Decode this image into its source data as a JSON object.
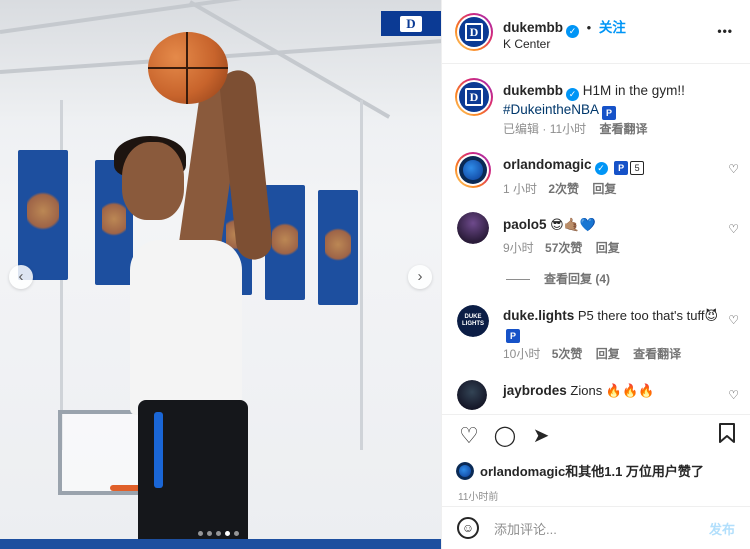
{
  "header": {
    "username": "dukembb",
    "follow_label": "关注",
    "location": "K Center",
    "more_label": "•••"
  },
  "caption": {
    "username": "dukembb",
    "text": "H1M in the gym!!",
    "hashtag": "#DukeintheNBA",
    "badge": "P",
    "edited": "已编辑",
    "time": "11小时",
    "translate": "查看翻译"
  },
  "comments": [
    {
      "username": "orlandomagic",
      "text": "",
      "badges": [
        "P",
        "5"
      ],
      "time": "1 小时",
      "likes": "2次赞",
      "reply": "回复"
    },
    {
      "username": "paolo5",
      "text": "😎🤙🏽💙",
      "time": "9小时",
      "likes": "57次赞",
      "reply": "回复",
      "view_replies": "查看回复 (4)"
    },
    {
      "username": "duke.lights",
      "text": "P5 there too that's tuff😈",
      "badge": "P",
      "time": "10小时",
      "likes": "5次赞",
      "reply": "回复",
      "translate": "查看翻译"
    },
    {
      "username": "jaybrodes",
      "text": "Zions 🔥🔥🔥"
    }
  ],
  "likes": {
    "username": "orlandomagic",
    "text": "和其他1.1 万位用户赞了"
  },
  "posted_ago": "11小时前",
  "add_comment": {
    "placeholder": "添加评论...",
    "post_label": "发布"
  },
  "photo": {
    "tag": "D"
  },
  "icons": {
    "heart": "heart-icon",
    "comment": "comment-icon",
    "share": "share-icon",
    "save": "bookmark-icon",
    "emoji": "emoji-icon",
    "prev": "chevron-left-icon",
    "next": "chevron-right-icon"
  },
  "colors": {
    "accent": "#0095f6",
    "duke_blue": "#0b3a94"
  }
}
